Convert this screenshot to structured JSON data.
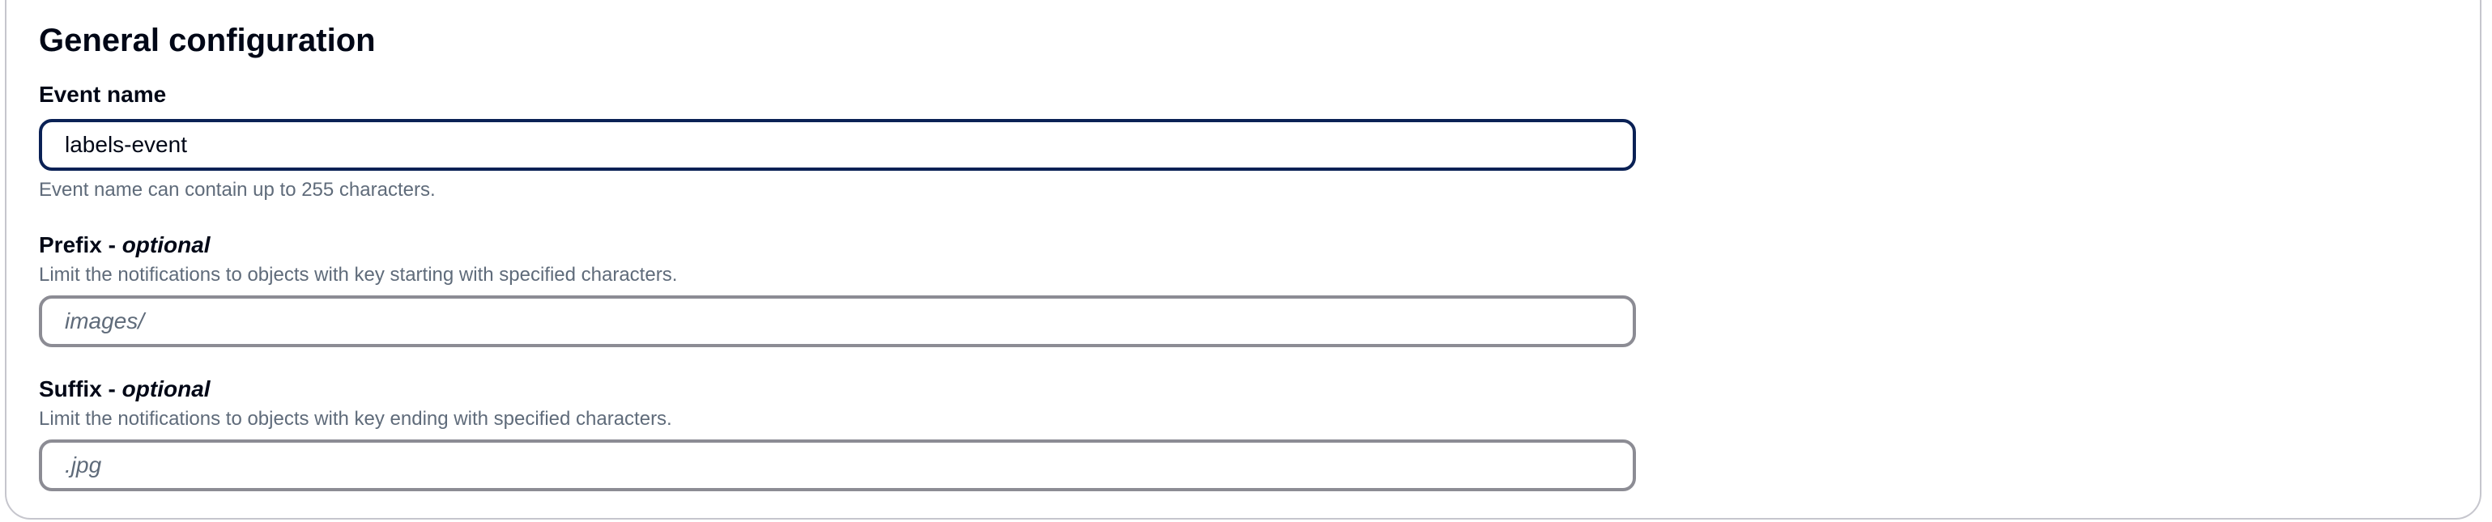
{
  "section": {
    "title": "General configuration"
  },
  "event_name": {
    "label": "Event name",
    "value": "labels-event",
    "hint": "Event name can contain up to 255 characters."
  },
  "prefix": {
    "label": "Prefix - ",
    "optional": "optional",
    "description": "Limit the notifications to objects with key starting with specified characters.",
    "value": "",
    "placeholder": "images/"
  },
  "suffix": {
    "label": "Suffix - ",
    "optional": "optional",
    "description": "Limit the notifications to objects with key ending with specified characters.",
    "value": "",
    "placeholder": ".jpg"
  },
  "colors": {
    "focus_border": "#0a2155",
    "input_border": "#8c8c94",
    "description_text": "#5f6b7a"
  }
}
